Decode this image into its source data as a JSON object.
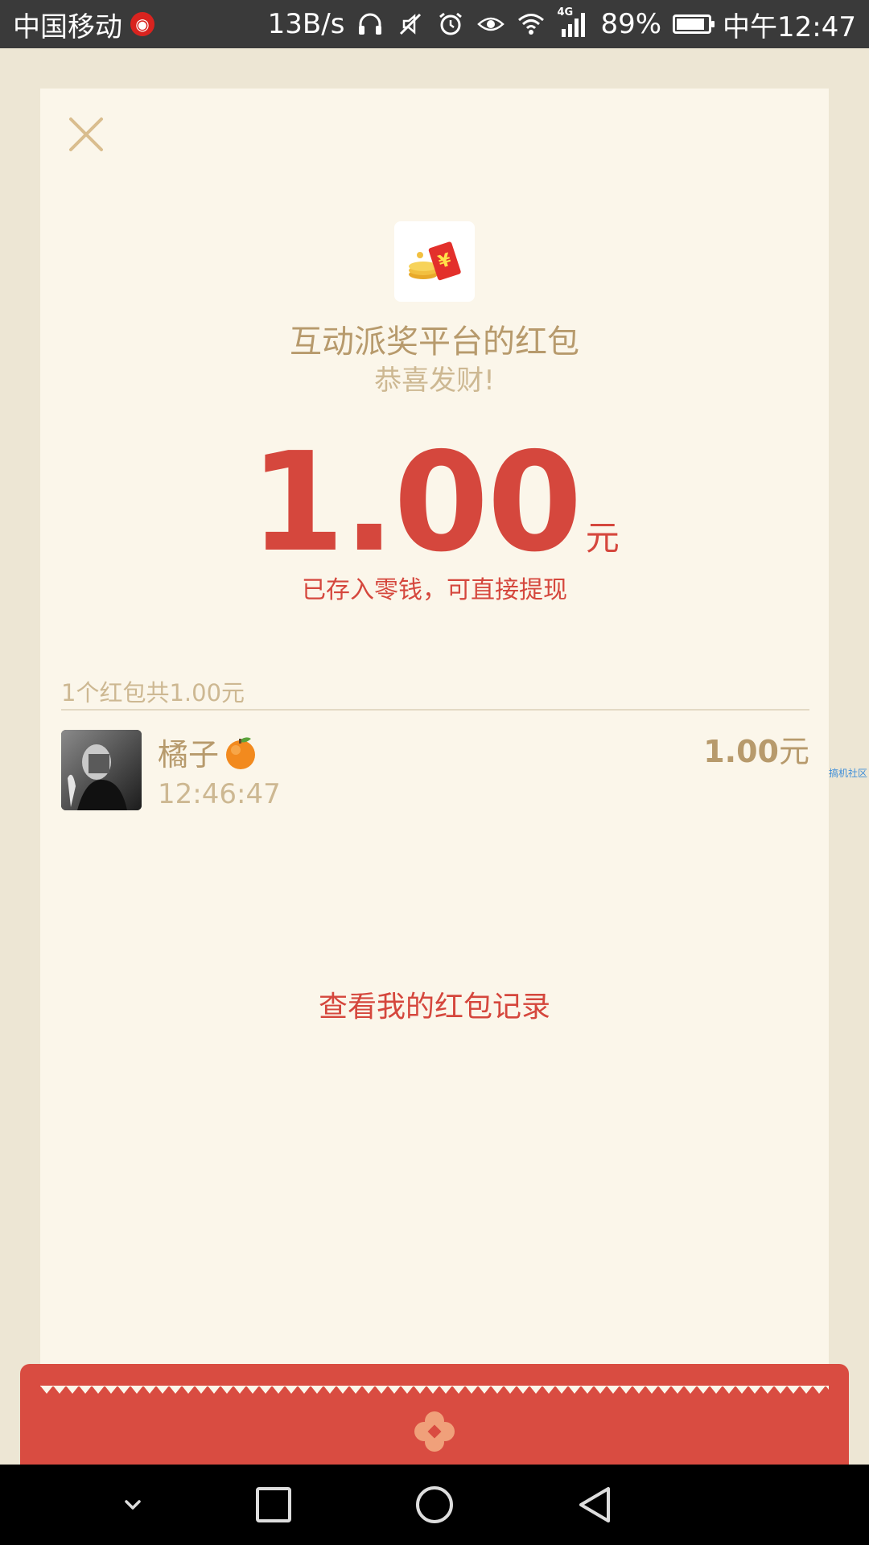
{
  "status_bar": {
    "carrier": "中国移动",
    "net_speed": "13B/s",
    "network_type": "4G",
    "battery_percent": "89%",
    "battery_level": 0.89,
    "time": "中午12:47"
  },
  "card": {
    "sender_title": "互动派奖平台的红包",
    "greeting": "恭喜发财!",
    "amount_value": "1.00",
    "amount_unit": "元",
    "deposit_note": "已存入零钱，可直接提现",
    "summary": "1个红包共1.00元",
    "records": [
      {
        "name": "橘子",
        "time": "12:46:47",
        "amount": "1.00",
        "unit": "元"
      }
    ],
    "history_link": "查看我的红包记录"
  },
  "watermark": "搞机社区",
  "icons": {
    "close": "close-icon",
    "logo": "red-envelope-logo-icon",
    "orange": "orange-emoji-icon",
    "emblem": "envelope-emblem-icon",
    "nav": [
      "collapse-icon",
      "recents-icon",
      "home-icon",
      "back-icon"
    ]
  },
  "colors": {
    "accent_red": "#D5473D",
    "gold_text": "#B79A6C",
    "light_gold_text": "#CDB892",
    "card_bg": "#FBF6EA",
    "page_bg": "#EDE6D4",
    "envelope_red": "#D94C41"
  }
}
